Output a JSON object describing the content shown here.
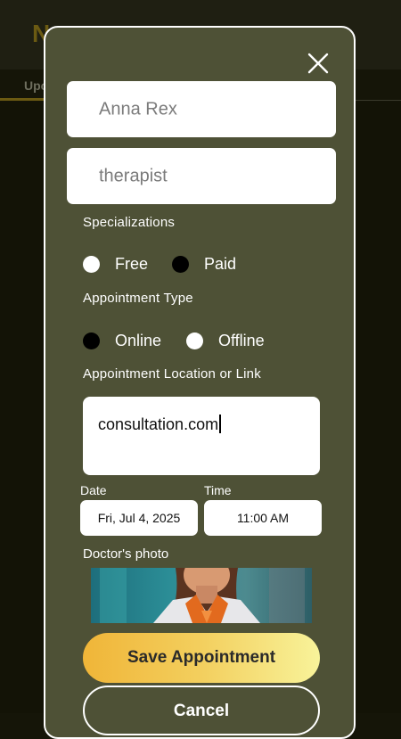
{
  "background": {
    "logo_text": "N",
    "tab_label": "Upc"
  },
  "modal": {
    "name_value": "Anna Rex",
    "role_value": "therapist",
    "specializations_label": "Specializations",
    "payment_options": [
      {
        "label": "Free",
        "selected": false
      },
      {
        "label": "Paid",
        "selected": true
      }
    ],
    "appointment_type_label": "Appointment Type",
    "appointment_types": [
      {
        "label": "Online",
        "selected": true
      },
      {
        "label": "Offline",
        "selected": false
      }
    ],
    "location_label": "Appointment Location or Link",
    "location_value": "consultation.com",
    "date_label": "Date",
    "date_value": "Fri, Jul 4, 2025",
    "time_label": "Time",
    "time_value": "11:00 AM",
    "photo_label": "Doctor's photo",
    "save_label": "Save Appointment",
    "cancel_label": "Cancel"
  },
  "colors": {
    "modal_bg": "#4e5136",
    "accent_gold": "#f0b538",
    "field_bg": "#ffffff"
  },
  "icons": {
    "close": "close-icon"
  }
}
